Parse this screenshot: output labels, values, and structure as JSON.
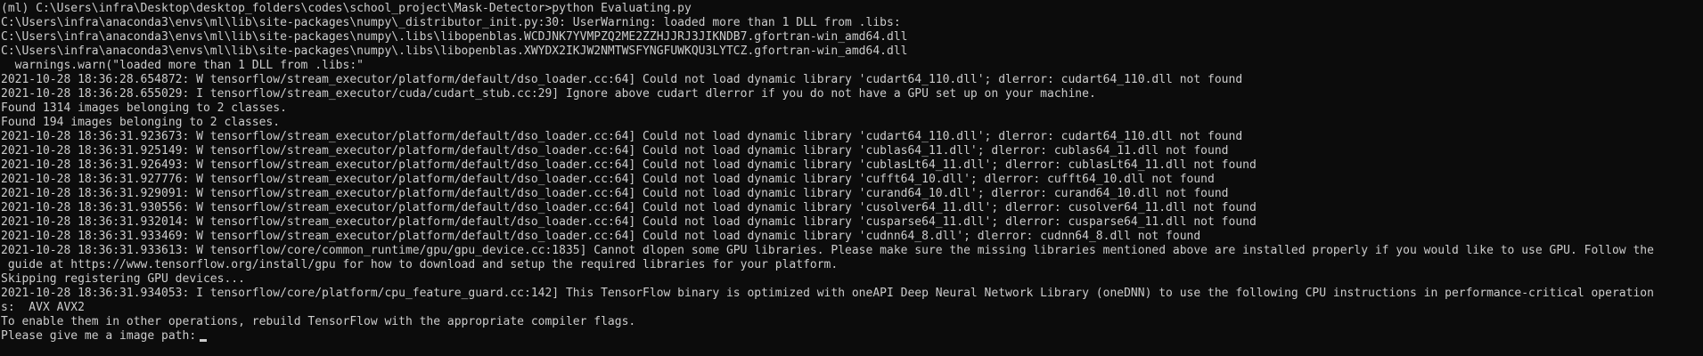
{
  "terminal": {
    "lines": [
      "(ml) C:\\Users\\infra\\Desktop\\desktop_folders\\codes\\school_project\\Mask-Detector>python Evaluating.py",
      "C:\\Users\\infra\\anaconda3\\envs\\ml\\lib\\site-packages\\numpy\\_distributor_init.py:30: UserWarning: loaded more than 1 DLL from .libs:",
      "C:\\Users\\infra\\anaconda3\\envs\\ml\\lib\\site-packages\\numpy\\.libs\\libopenblas.WCDJNK7YVMPZQ2ME2ZZHJJRJ3JIKNDB7.gfortran-win_amd64.dll",
      "C:\\Users\\infra\\anaconda3\\envs\\ml\\lib\\site-packages\\numpy\\.libs\\libopenblas.XWYDX2IKJW2NMTWSFYNGFUWKQU3LYTCZ.gfortran-win_amd64.dll",
      "  warnings.warn(\"loaded more than 1 DLL from .libs:\"",
      "2021-10-28 18:36:28.654872: W tensorflow/stream_executor/platform/default/dso_loader.cc:64] Could not load dynamic library 'cudart64_110.dll'; dlerror: cudart64_110.dll not found",
      "2021-10-28 18:36:28.655029: I tensorflow/stream_executor/cuda/cudart_stub.cc:29] Ignore above cudart dlerror if you do not have a GPU set up on your machine.",
      "Found 1314 images belonging to 2 classes.",
      "Found 194 images belonging to 2 classes.",
      "2021-10-28 18:36:31.923673: W tensorflow/stream_executor/platform/default/dso_loader.cc:64] Could not load dynamic library 'cudart64_110.dll'; dlerror: cudart64_110.dll not found",
      "2021-10-28 18:36:31.925149: W tensorflow/stream_executor/platform/default/dso_loader.cc:64] Could not load dynamic library 'cublas64_11.dll'; dlerror: cublas64_11.dll not found",
      "2021-10-28 18:36:31.926493: W tensorflow/stream_executor/platform/default/dso_loader.cc:64] Could not load dynamic library 'cublasLt64_11.dll'; dlerror: cublasLt64_11.dll not found",
      "2021-10-28 18:36:31.927776: W tensorflow/stream_executor/platform/default/dso_loader.cc:64] Could not load dynamic library 'cufft64_10.dll'; dlerror: cufft64_10.dll not found",
      "2021-10-28 18:36:31.929091: W tensorflow/stream_executor/platform/default/dso_loader.cc:64] Could not load dynamic library 'curand64_10.dll'; dlerror: curand64_10.dll not found",
      "2021-10-28 18:36:31.930556: W tensorflow/stream_executor/platform/default/dso_loader.cc:64] Could not load dynamic library 'cusolver64_11.dll'; dlerror: cusolver64_11.dll not found",
      "2021-10-28 18:36:31.932014: W tensorflow/stream_executor/platform/default/dso_loader.cc:64] Could not load dynamic library 'cusparse64_11.dll'; dlerror: cusparse64_11.dll not found",
      "2021-10-28 18:36:31.933469: W tensorflow/stream_executor/platform/default/dso_loader.cc:64] Could not load dynamic library 'cudnn64_8.dll'; dlerror: cudnn64_8.dll not found",
      "2021-10-28 18:36:31.933613: W tensorflow/core/common_runtime/gpu/gpu_device.cc:1835] Cannot dlopen some GPU libraries. Please make sure the missing libraries mentioned above are installed properly if you would like to use GPU. Follow the",
      " guide at https://www.tensorflow.org/install/gpu for how to download and setup the required libraries for your platform.",
      "Skipping registering GPU devices...",
      "2021-10-28 18:36:31.934053: I tensorflow/core/platform/cpu_feature_guard.cc:142] This TensorFlow binary is optimized with oneAPI Deep Neural Network Library (oneDNN) to use the following CPU instructions in performance-critical operation",
      "s:  AVX AVX2",
      "To enable them in other operations, rebuild TensorFlow with the appropriate compiler flags."
    ],
    "input_prompt": "Please give me a image path:",
    "colors": {
      "background": "#0c0c0c",
      "text": "#cccccc"
    }
  }
}
